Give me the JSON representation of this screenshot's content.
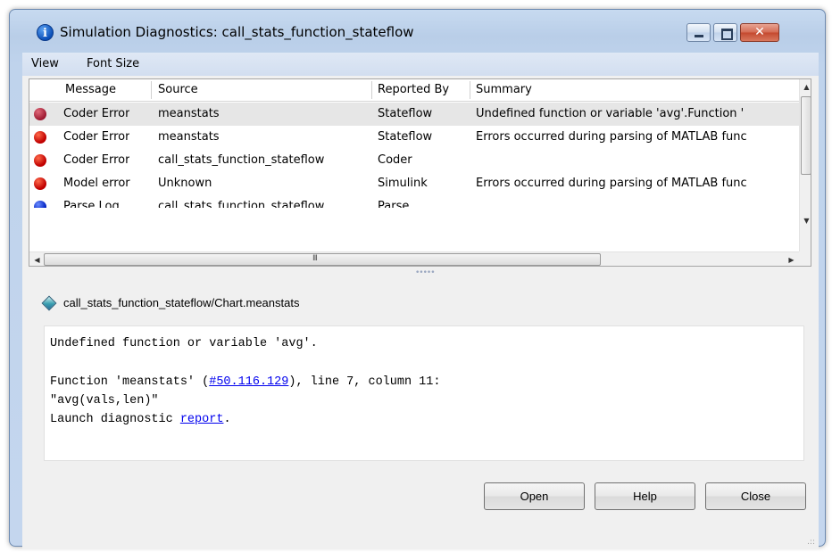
{
  "window": {
    "title": "Simulation Diagnostics: call_stats_function_stateflow",
    "title_icon": "info-icon",
    "controls": {
      "minimize": "minimize",
      "maximize": "maximize",
      "close": "✕"
    }
  },
  "menu": {
    "items": [
      {
        "label": "View"
      },
      {
        "label": "Font Size"
      }
    ]
  },
  "table": {
    "columns": [
      "Message",
      "Source",
      "Reported By",
      "Summary"
    ],
    "rows": [
      {
        "icon": "error-icon",
        "message": "Coder Error",
        "source": "meanstats",
        "reported_by": "Stateflow",
        "summary": "Undefined function or variable 'avg'.Function '",
        "selected": true
      },
      {
        "icon": "error-icon",
        "message": "Coder Error",
        "source": "meanstats",
        "reported_by": "Stateflow",
        "summary": "Errors occurred during parsing of MATLAB func",
        "selected": false
      },
      {
        "icon": "error-icon",
        "message": "Coder Error",
        "source": "call_stats_function_stateflow",
        "reported_by": "Coder",
        "summary": "",
        "selected": false
      },
      {
        "icon": "error-icon",
        "message": "Model error",
        "source": "Unknown",
        "reported_by": "Simulink",
        "summary": "Errors occurred during parsing of MATLAB func",
        "selected": false
      },
      {
        "icon": "info-icon",
        "message": "Parse Log",
        "source": "call_stats_function_stateflow",
        "reported_by": "Parse",
        "summary": "",
        "selected": false
      }
    ],
    "hscroll_grip": "III"
  },
  "splitter_grip": "•••••",
  "detail": {
    "path": "call_stats_function_stateflow/Chart.meanstats",
    "line1": "Undefined function or variable 'avg'.",
    "line2_prefix": "Function 'meanstats' (",
    "line2_link": "#50.116.129",
    "line2_suffix": "), line 7, column 11:",
    "line3": "\"avg(vals,len)\"",
    "line4_prefix": "Launch diagnostic ",
    "line4_link": "report",
    "line4_suffix": "."
  },
  "buttons": {
    "open": "Open",
    "help": "Help",
    "close": "Close"
  }
}
